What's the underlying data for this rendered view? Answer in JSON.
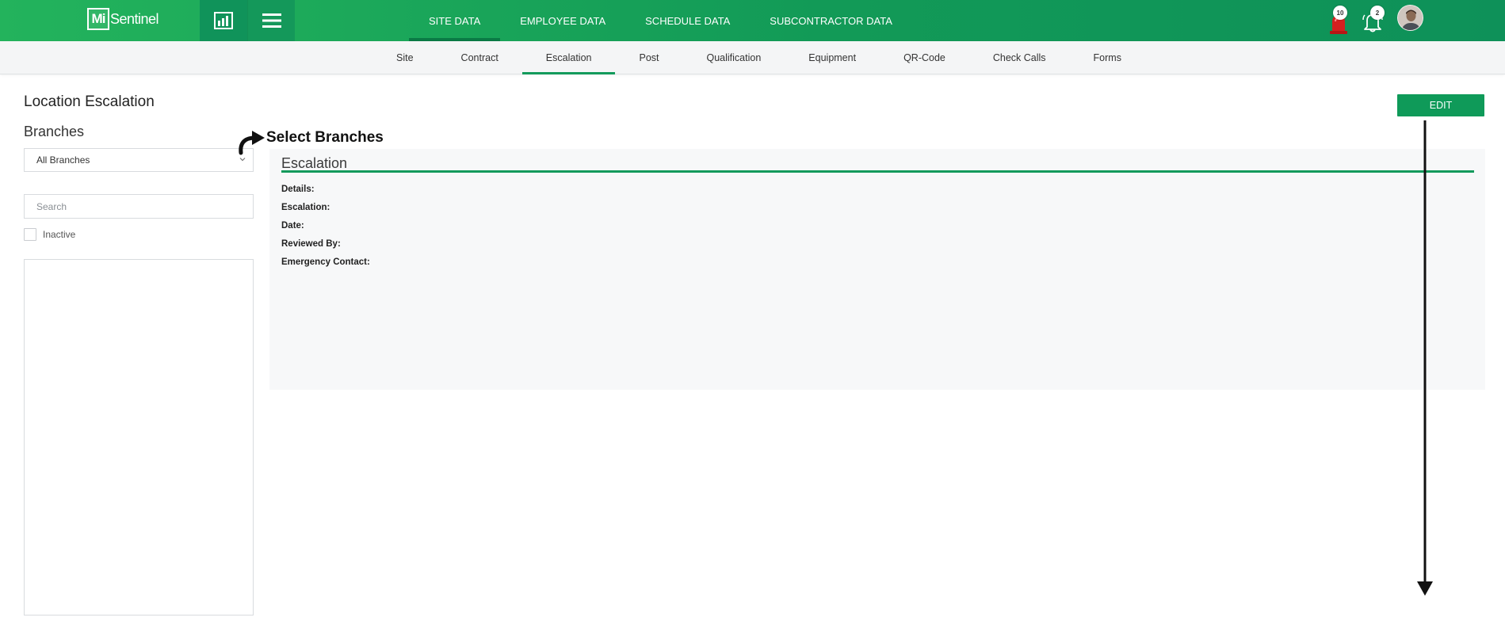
{
  "topbar": {
    "logo_mark": "Mi",
    "logo_text": "Sentinel",
    "nav": [
      {
        "label": "SITE DATA",
        "active": true
      },
      {
        "label": "EMPLOYEE DATA",
        "active": false
      },
      {
        "label": "SCHEDULE DATA",
        "active": false
      },
      {
        "label": "SUBCONTRACTOR DATA",
        "active": false
      }
    ],
    "alerts_count": "10",
    "notifications_count": "2",
    "icons": {
      "dashboard": "chart-icon",
      "menu": "hamburger-menu-icon",
      "alerts": "alarm-siren-icon",
      "notifications": "bell-icon"
    }
  },
  "subnav": {
    "tabs": [
      {
        "label": "Site",
        "active": false
      },
      {
        "label": "Contract",
        "active": false
      },
      {
        "label": "Escalation",
        "active": true
      },
      {
        "label": "Post",
        "active": false
      },
      {
        "label": "Qualification",
        "active": false
      },
      {
        "label": "Equipment",
        "active": false
      },
      {
        "label": "QR-Code",
        "active": false
      },
      {
        "label": "Check Calls",
        "active": false
      },
      {
        "label": "Forms",
        "active": false
      }
    ]
  },
  "page": {
    "title": "Location Escalation",
    "edit_label": "EDIT"
  },
  "sidebar": {
    "branches_label": "Branches",
    "branch_selected": "All Branches",
    "search_placeholder": "Search",
    "inactive_label": "Inactive"
  },
  "annotation": {
    "select_branches": "Select Branches"
  },
  "escalation": {
    "title": "Escalation",
    "fields": [
      "Details:",
      "Escalation:",
      "Date:",
      "Reviewed By:",
      "Emergency Contact:"
    ]
  },
  "colors": {
    "brand_green": "#129a57",
    "accent_green": "#139a5c",
    "alert_red": "#d4201f"
  }
}
